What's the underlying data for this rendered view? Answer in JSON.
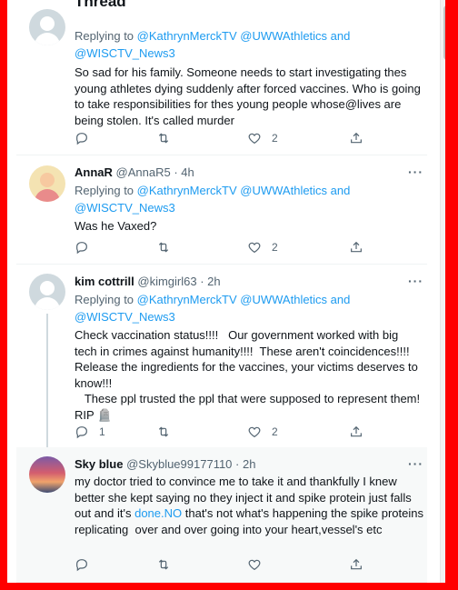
{
  "header": {
    "title": "Thread"
  },
  "tweets": [
    {
      "name": "",
      "handle": "",
      "time": "",
      "reply_prefix": "Replying to",
      "reply_handles": "@KathrynMerckTV @UWWAthletics and @WISCTV_News3",
      "text": "So sad for his family. Someone needs to start investigating thes young athletes dying suddenly after forced vaccines. Who is going to take responsibilities for thes young people whose@lives are being stolen. It's called murder",
      "replies": "",
      "retweets": "",
      "likes": "2"
    },
    {
      "name": "AnnaR",
      "handle": "@AnnaR5",
      "time": "· 4h",
      "reply_prefix": "Replying to",
      "reply_handles": "@KathrynMerckTV @UWWAthletics and @WISCTV_News3",
      "text": "Was he Vaxed?",
      "replies": "",
      "retweets": "",
      "likes": "2"
    },
    {
      "name": "kim cottrill",
      "handle": "@kimgirl63",
      "time": "· 2h",
      "reply_prefix": "Replying to",
      "reply_handles": "@KathrynMerckTV @UWWAthletics and @WISCTV_News3",
      "text": "Check vaccination status!!!!   Our government worked with big tech in crimes against humanity!!!!  These aren't coincidences!!!! Release the ingredients for the vaccines, your victims deserves to know!!!\n   These ppl trusted the ppl that were supposed to represent them! RIP 🪦",
      "replies": "1",
      "retweets": "",
      "likes": "2"
    },
    {
      "name": "Sky blue",
      "handle": "@Skyblue99177110",
      "time": "· 2h",
      "text_before_link": "my doctor tried to convince me to take it and thankfully I knew better she kept saying no they inject it and spike protein just falls out and it's ",
      "link_text": "done.NO",
      "text_after_link": " that's not what's happening the spike proteins replicating  over and over going into your heart,vessel's etc",
      "replies": "",
      "retweets": "",
      "likes": ""
    }
  ],
  "colors": {
    "border": "#ff0000",
    "link": "#1d9bf0",
    "muted": "#536471"
  }
}
